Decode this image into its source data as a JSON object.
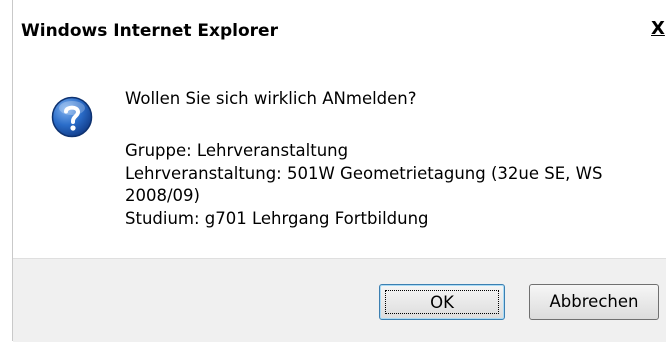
{
  "dialog": {
    "title": "Windows Internet Explorer",
    "close_label": "X",
    "icon": "question-icon",
    "question": "Wollen Sie sich wirklich ANmelden?",
    "details": [
      "Gruppe: Lehrveranstaltung",
      "Lehrveranstaltung: 501W Geometrietagung (32ue SE, WS",
      "2008/09)",
      "Studium: g701 Lehrgang Fortbildung"
    ],
    "buttons": {
      "ok": "OK",
      "cancel": "Abbrechen"
    }
  },
  "colors": {
    "footer_bg": "#f0f0f0",
    "icon_blue": "#1f5fb4"
  }
}
